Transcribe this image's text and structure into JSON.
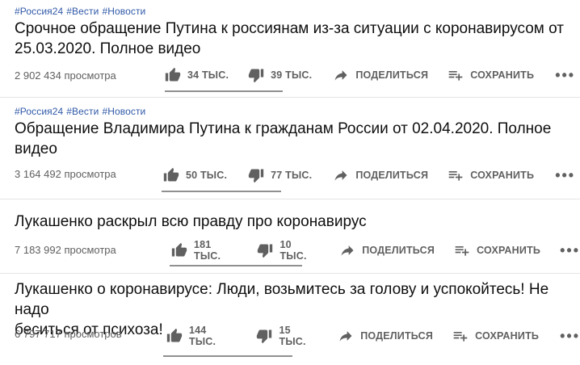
{
  "videos": [
    {
      "tags": [
        "#Россия24",
        "#Вести",
        "#Новости"
      ],
      "title_line1": "Срочное обращение Путина к россиянам из-за ситуации с коронавирусом от",
      "title_line2": "25.03.2020. Полное видео",
      "views": "2 902 434 просмотра",
      "likes": "34 ТЫС.",
      "dislikes": "39 ТЫС.",
      "share": "ПОДЕЛИТЬСЯ",
      "save": "СОХРАНИТЬ",
      "like_ratio": 0.47
    },
    {
      "tags": [
        "#Россия24",
        "#Вести",
        "#Новости"
      ],
      "title_line1": "Обращение Владимира Путина к гражданам России от 02.04.2020. Полное",
      "title_line2": "видео",
      "views": "3 164 492 просмотра",
      "likes": "50 ТЫС.",
      "dislikes": "77 ТЫС.",
      "share": "ПОДЕЛИТЬСЯ",
      "save": "СОХРАНИТЬ",
      "like_ratio": 0.39
    },
    {
      "tags": [],
      "title_line1": "Лукашенко раскрыл всю правду про коронавирус",
      "title_line2": "",
      "views": "7 183 992 просмотра",
      "likes": "181 ТЫС.",
      "dislikes": "10 ТЫС.",
      "share": "ПОДЕЛИТЬСЯ",
      "save": "СОХРАНИТЬ",
      "like_ratio": 0.95
    },
    {
      "tags": [],
      "title_line1": "Лукашенко о коронавирусе: Люди, возьмитесь за голову и успокойтесь! Не надо",
      "title_line2": "беситься от психоза!",
      "views": "6 797 717 просмотров",
      "likes": "144 ТЫС.",
      "dislikes": "15 ТЫС.",
      "share": "ПОДЕЛИТЬСЯ",
      "save": "СОХРАНИТЬ",
      "like_ratio": 0.91
    }
  ],
  "icons": {
    "like": "thumb-up-icon",
    "dislike": "thumb-down-icon",
    "share": "share-arrow-icon",
    "save": "playlist-add-icon",
    "more": "more-horizontal-icon"
  },
  "colors": {
    "tag_link": "#3059a8",
    "secondary_text": "#606060",
    "sentiment_bar": "#909090"
  }
}
